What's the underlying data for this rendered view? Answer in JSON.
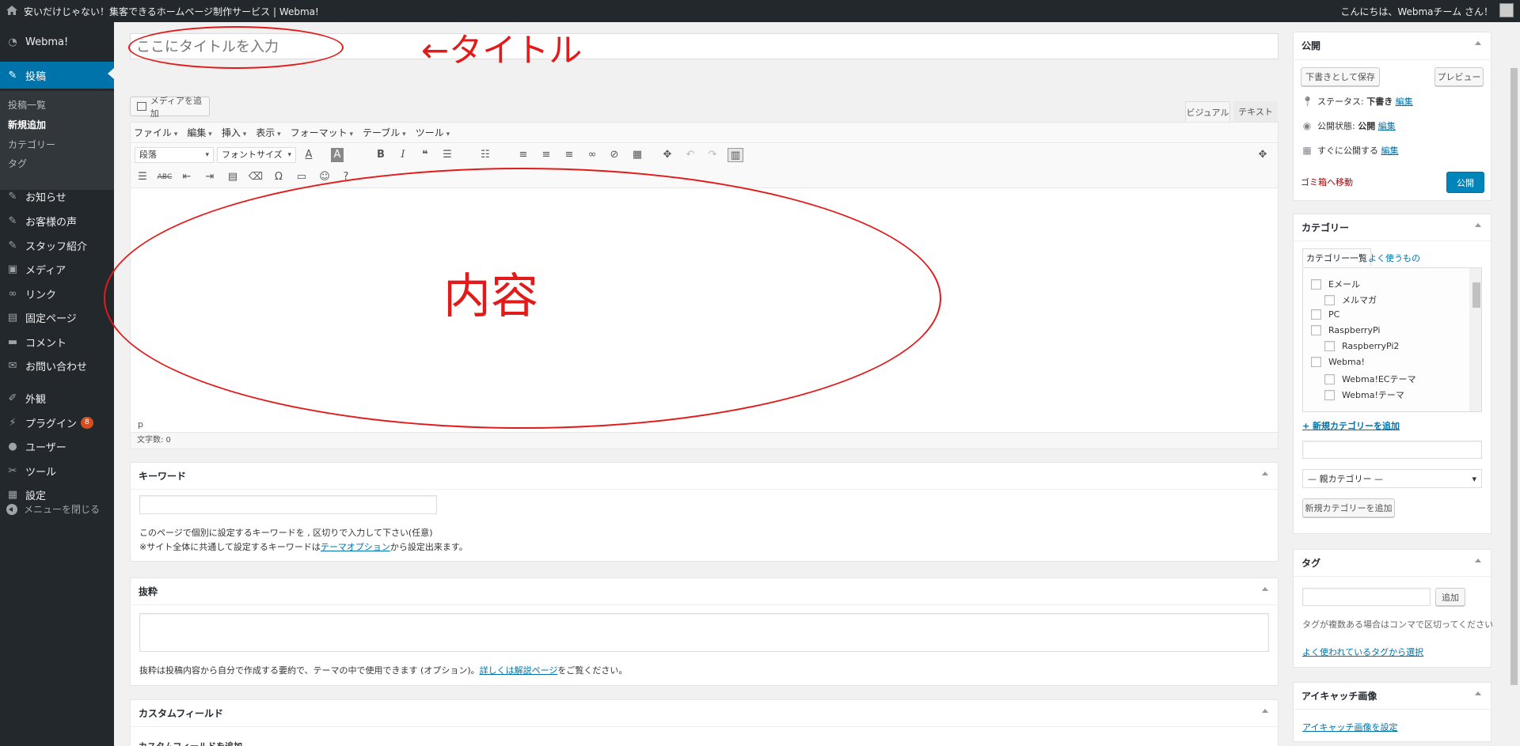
{
  "adminbar": {
    "site_name": "安いだけじゃない！集客できるホームページ制作サービス | Webma!",
    "howdy": "こんにちは、Webmaチーム さん！"
  },
  "sidebar": {
    "brand": "Webma!",
    "items": [
      {
        "label": "投稿",
        "icon": "pin-icon"
      },
      {
        "label": "お知らせ",
        "icon": "pin-icon"
      },
      {
        "label": "お客様の声",
        "icon": "pin-icon"
      },
      {
        "label": "スタッフ紹介",
        "icon": "pin-icon"
      },
      {
        "label": "メディア",
        "icon": "media-icon"
      },
      {
        "label": "リンク",
        "icon": "link-icon"
      },
      {
        "label": "固定ページ",
        "icon": "page-icon"
      },
      {
        "label": "コメント",
        "icon": "comment-icon"
      },
      {
        "label": "お問い合わせ",
        "icon": "mail-icon"
      },
      {
        "label": "外観",
        "icon": "brush-icon"
      },
      {
        "label": "プラグイン",
        "icon": "plugin-icon",
        "badge": "8"
      },
      {
        "label": "ユーザー",
        "icon": "user-icon"
      },
      {
        "label": "ツール",
        "icon": "wrench-icon"
      },
      {
        "label": "設定",
        "icon": "settings-icon"
      }
    ],
    "submenu": [
      "投稿一覧",
      "新規追加",
      "カテゴリー",
      "タグ"
    ],
    "collapse": "メニューを閉じる"
  },
  "title": {
    "placeholder": "ここにタイトルを入力",
    "annotation": "←タイトル"
  },
  "editor": {
    "media_button": "メディアを追加",
    "tab_visual": "ビジュアル",
    "tab_text": "テキスト",
    "menus": [
      "ファイル",
      "編集",
      "挿入",
      "表示",
      "フォーマット",
      "テーブル",
      "ツール"
    ],
    "format_select": "段落",
    "fontsize_select": "フォントサイズ",
    "annotation": "内容",
    "path": "p",
    "wordcount": "文字数: 0"
  },
  "keyword_box": {
    "title": "キーワード",
    "desc1": "このページで個別に設定するキーワードを , 区切りで入力して下さい(任意)",
    "desc2_pre": "※サイト全体に共通して設定するキーワードは",
    "desc2_link": "テーマオプション",
    "desc2_post": "から設定出来ます。"
  },
  "excerpt_box": {
    "title": "抜粋",
    "desc_pre": "抜粋は投稿内容から自分で作成する要約で、テーマの中で使用できます (オプション)。",
    "desc_link": "詳しくは解説ページ",
    "desc_post": "をご覧ください。"
  },
  "custom_fields": {
    "title": "カスタムフィールド",
    "add_label": "カスタムフィールドを追加"
  },
  "publish": {
    "title": "公開",
    "save_draft": "下書きとして保存",
    "preview": "プレビュー",
    "status_label": "ステータス:",
    "status_value": "下書き",
    "visibility_label": "公開状態:",
    "visibility_value": "公開",
    "schedule_label": "すぐに公開する",
    "edit": "編集",
    "trash": "ゴミ箱へ移動",
    "publish_button": "公開"
  },
  "categories": {
    "title": "カテゴリー",
    "tab_all": "カテゴリー一覧",
    "tab_popular": "よく使うもの",
    "items": [
      {
        "label": "Eメール",
        "level": 0
      },
      {
        "label": "メルマガ",
        "level": 1
      },
      {
        "label": "PC",
        "level": 0
      },
      {
        "label": "RaspberryPi",
        "level": 0
      },
      {
        "label": "RaspberryPi2",
        "level": 1
      },
      {
        "label": "Webma!",
        "level": 0
      },
      {
        "label": "Webma!ECテーマ",
        "level": 1
      },
      {
        "label": "Webma!テーマ",
        "level": 1
      }
    ],
    "add_new_link": "+ 新規カテゴリーを追加",
    "parent_select": "— 親カテゴリー —",
    "add_button": "新規カテゴリーを追加"
  },
  "tags": {
    "title": "タグ",
    "add_button": "追加",
    "hint": "タグが複数ある場合はコンマで区切ってください",
    "popular_link": "よく使われているタグから選択"
  },
  "featured_image": {
    "title": "アイキャッチ画像",
    "set_link": "アイキャッチ画像を設定"
  },
  "colors": {
    "accent": "#0073aa",
    "sidebar_bg": "#23282d",
    "annotation_red": "#e21a1a",
    "trash_red": "#a00"
  }
}
